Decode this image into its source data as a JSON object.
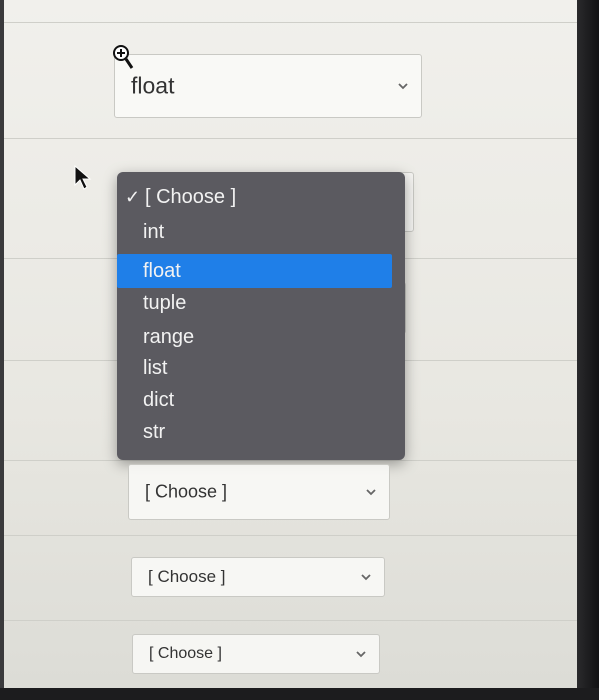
{
  "top_select": {
    "value": "float",
    "icon": "chevron-down-icon"
  },
  "dropdown": {
    "options": [
      {
        "label": "[ Choose ]",
        "checked": true
      },
      {
        "label": "int"
      },
      {
        "label": "float",
        "highlighted": true
      },
      {
        "label": "tuple"
      },
      {
        "label": "range"
      },
      {
        "label": "list"
      },
      {
        "label": "dict"
      },
      {
        "label": "str"
      }
    ],
    "check_symbol": "✓",
    "highlight_color": "#1f7fe8",
    "background_color": "#5b5a60"
  },
  "lower_selects": [
    {
      "value": "[ Choose ]"
    },
    {
      "value": "[ Choose ]"
    },
    {
      "value": "[ Choose ]"
    }
  ]
}
